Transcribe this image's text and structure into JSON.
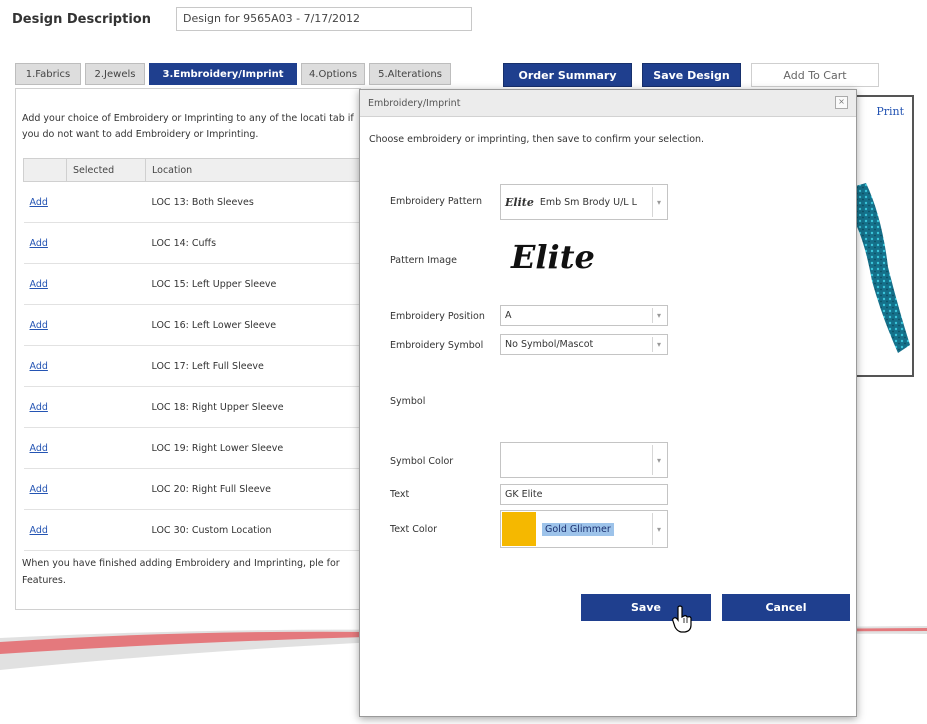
{
  "header": {
    "design_description_label": "Design Description",
    "design_description_value": "Design for 9565A03 - 7/17/2012"
  },
  "tabs": [
    {
      "label": "1.Fabrics"
    },
    {
      "label": "2.Jewels"
    },
    {
      "label": "3.Embroidery/Imprint"
    },
    {
      "label": "4.Options"
    },
    {
      "label": "5.Alterations"
    }
  ],
  "actions": {
    "order_summary": "Order Summary",
    "save_design": "Save Design",
    "add_to_cart": "Add To Cart"
  },
  "left_panel": {
    "intro": "Add your choice of Embroidery or Imprinting to any of the locati tab if you do not want to add Embroidery or Imprinting.",
    "columns": [
      "",
      "Selected",
      "Location"
    ],
    "rows": [
      {
        "action": "Add",
        "selected": "",
        "location": "LOC 13: Both Sleeves"
      },
      {
        "action": "Add",
        "selected": "",
        "location": "LOC 14: Cuffs"
      },
      {
        "action": "Add",
        "selected": "",
        "location": "LOC 15: Left Upper Sleeve"
      },
      {
        "action": "Add",
        "selected": "",
        "location": "LOC 16: Left Lower Sleeve"
      },
      {
        "action": "Add",
        "selected": "",
        "location": "LOC 17: Left Full Sleeve"
      },
      {
        "action": "Add",
        "selected": "",
        "location": "LOC 18: Right Upper Sleeve"
      },
      {
        "action": "Add",
        "selected": "",
        "location": "LOC 19: Right Lower Sleeve"
      },
      {
        "action": "Add",
        "selected": "",
        "location": "LOC 20: Right Full Sleeve"
      },
      {
        "action": "Add",
        "selected": "",
        "location": "LOC 30: Custom Location"
      }
    ],
    "finish_note": "When you have finished adding Embroidery and Imprinting, ple for Features."
  },
  "preview": {
    "print_label": "Print"
  },
  "modal": {
    "title": "Embroidery/Imprint",
    "close_glyph": "×",
    "instruction": "Choose embroidery or imprinting, then save to confirm your selection.",
    "embroidery_pattern_label": "Embroidery Pattern",
    "embroidery_pattern_icon_text": "Elite",
    "embroidery_pattern_value": "Emb Sm Brody U/L L",
    "pattern_image_label": "Pattern Image",
    "pattern_image_text": "Elite",
    "embroidery_position_label": "Embroidery Position",
    "embroidery_position_value": "A",
    "embroidery_symbol_label": "Embroidery Symbol",
    "embroidery_symbol_value": "No Symbol/Mascot",
    "symbol_label": "Symbol",
    "symbol_color_label": "Symbol Color",
    "symbol_color_value": "",
    "text_label": "Text",
    "text_value": "GK Elite",
    "text_color_label": "Text Color",
    "text_color_value": "Gold Glimmer",
    "text_color_swatch": "#f5b800",
    "save_label": "Save",
    "cancel_label": "Cancel",
    "dropdown_arrow": "▾"
  },
  "colors": {
    "primary_button": "#1f3f8e",
    "link": "#2454b3",
    "sleeve": "#1e8aa8"
  }
}
